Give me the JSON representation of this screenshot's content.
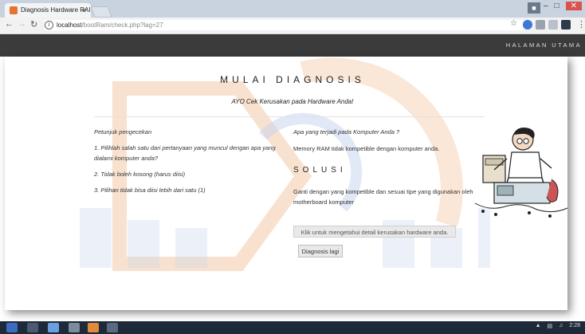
{
  "browser": {
    "tab_title": "Diagnosis Hardware RAI",
    "tab_close": "×",
    "url_host": "localhost",
    "url_path": "/bootRam/check.php?lag=27",
    "clock": "2:28"
  },
  "nav": {
    "home": "HALAMAN UTAMA"
  },
  "page": {
    "title": "MULAI DIAGNOSIS",
    "subtitle": "AYO Cek Kerusakan pada Hardware Anda!"
  },
  "instructions": {
    "heading": "Petunjuk pengecekan",
    "items": [
      "1. Pilihlah salah satu dari pertanyaan yang muncul dengan apa yang dialami komputer anda?",
      "2. Tidak boleh kosong (harus diisi)",
      "3. Pilihan tidak bisa diisi lebih dari satu (1)"
    ]
  },
  "result": {
    "question": "Apa yang terjadi pada Komputer Anda ?",
    "answer": "Memory RAM tidak kompetible dengan komputer anda.",
    "solution_heading": "SOLUSI",
    "solution_text": "Ganti dengan yang kompetible dan sesuai tipe yang digunakan oleh motherboard komputer",
    "detail_button": "Klik untuk mengetahui detail kerusakan hardware anda.",
    "again_button": "Diagnosis lagi"
  },
  "colors": {
    "navbar": "#3b3b3b",
    "watermark_orange": "#f3c9a6",
    "watermark_blue": "#c8d6ee"
  }
}
